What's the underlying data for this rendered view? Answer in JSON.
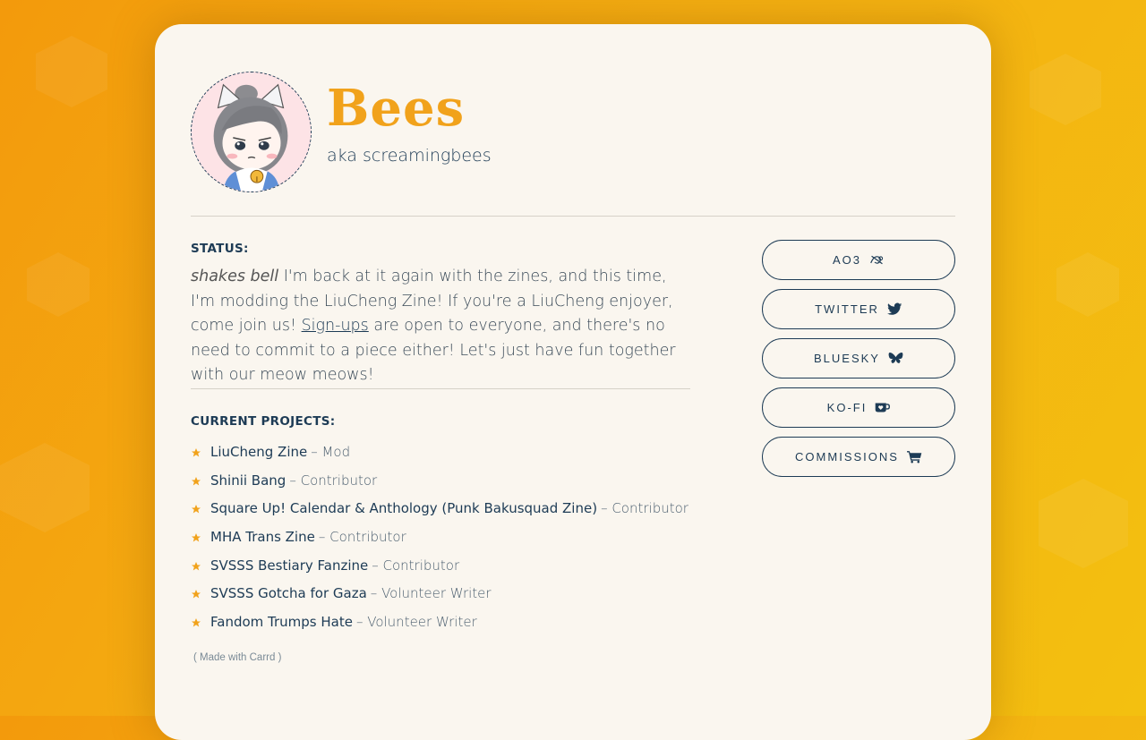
{
  "profile": {
    "name": "Bees",
    "aka": "aka screamingbees"
  },
  "status": {
    "label": "STATUS:",
    "lead_italic": "shakes bell",
    "text_1": " I'm back at it again with the zines, and this time, I'm modding the LiuCheng Zine! If you're a LiuCheng enjoyer, come join us! ",
    "link": "Sign-ups",
    "text_2": " are open to everyone, and there's no need to commit to a piece either! Let's just have fun together with our meow meows!"
  },
  "projects": {
    "label": "CURRENT PROJECTS:",
    "items": [
      {
        "name": "LiuCheng Zine",
        "role": "– Mod"
      },
      {
        "name": "Shinii Bang",
        "role": "– Contributor"
      },
      {
        "name": "Square Up! Calendar & Anthology (Punk Bakusquad Zine)",
        "role": "– Contributor"
      },
      {
        "name": "MHA Trans Zine",
        "role": "– Contributor"
      },
      {
        "name": "SVSSS Bestiary Fanzine",
        "role": "– Contributor"
      },
      {
        "name": "SVSSS Gotcha for Gaza",
        "role": "– Volunteer Writer"
      },
      {
        "name": "Fandom Trumps Hate",
        "role": "– Volunteer Writer"
      }
    ]
  },
  "links": [
    {
      "label": "AO3",
      "icon": "ao3-icon"
    },
    {
      "label": "TWITTER",
      "icon": "twitter-icon"
    },
    {
      "label": "BLUESKY",
      "icon": "bluesky-butterfly-icon"
    },
    {
      "label": "KO-FI",
      "icon": "kofi-cup-icon"
    },
    {
      "label": "COMMISSIONS",
      "icon": "shopping-cart-icon"
    }
  ],
  "footer": {
    "made_with": "( Made with Carrd )"
  },
  "colors": {
    "accent": "#f1a21b",
    "ink": "#1d3b55",
    "card": "#faf6ef"
  }
}
